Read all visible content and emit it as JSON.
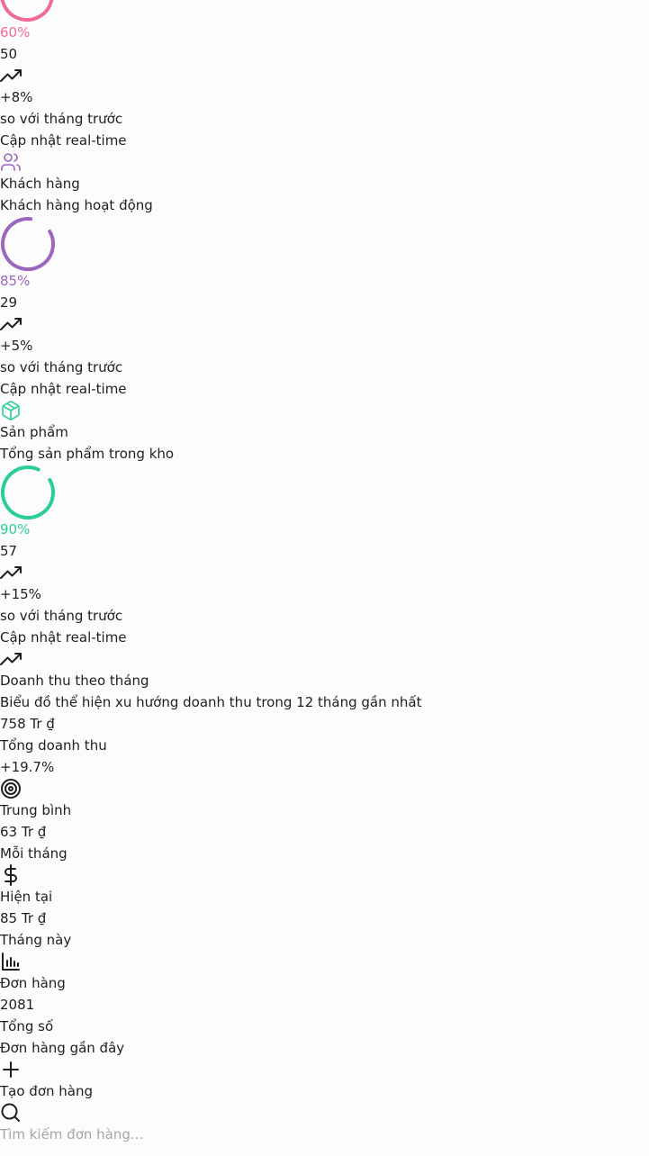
{
  "colors": {
    "pink": "#f06a9b",
    "purple": "#9b66bd",
    "green": "#2ccf93",
    "text": "#1f1f1f",
    "placeholder": "#a6a6a6"
  },
  "stat_cards": [
    {
      "icon": "progress-ring",
      "percent_label": "60%",
      "progress": 0.6,
      "value": "50",
      "trend_icon": "trending-up-icon",
      "trend": "+8%",
      "trend_note": "so với tháng trước",
      "update_note": "Cập nhật real-time"
    },
    {
      "icon": "users-icon",
      "title": "Khách hàng",
      "subtitle": "Khách hàng hoạt động",
      "percent_label": "85%",
      "progress": 0.85,
      "value": "29",
      "trend_icon": "trending-up-icon",
      "trend": "+5%",
      "trend_note": "so với tháng trước",
      "update_note": "Cập nhật real-time"
    },
    {
      "icon": "package-icon",
      "title": "Sản phẩm",
      "subtitle": "Tổng sản phẩm trong kho",
      "percent_label": "90%",
      "progress": 0.9,
      "value": "57",
      "trend_icon": "trending-up-icon",
      "trend": "+15%",
      "trend_note": "so với tháng trước",
      "update_note": "Cập nhật real-time"
    }
  ],
  "revenue": {
    "icon": "trending-up-icon",
    "title": "Doanh thu theo tháng",
    "description": "Biểu đồ thể hiện xu hướng doanh thu trong 12 tháng gần nhất",
    "total_value": "758 Tr ₫",
    "total_label": "Tổng doanh thu",
    "growth": "+19.7%",
    "average_icon": "target-icon",
    "average_label": "Trung bình",
    "average_value": "63 Tr ₫",
    "average_note": "Mỗi tháng",
    "current_icon": "dollar-icon",
    "current_label": "Hiện tại",
    "current_value": "85 Tr ₫",
    "current_note": "Tháng này",
    "orders_icon": "bar-chart-icon",
    "orders_label": "Đơn hàng",
    "orders_value": "2081",
    "orders_note": "Tổng số"
  },
  "recent_orders": {
    "title": "Đơn hàng gần đây",
    "create_icon": "plus-icon",
    "create_label": "Tạo đơn hàng",
    "search_icon": "search-icon",
    "search_placeholder": "Tìm kiếm đơn hàng...",
    "search_value": ""
  }
}
